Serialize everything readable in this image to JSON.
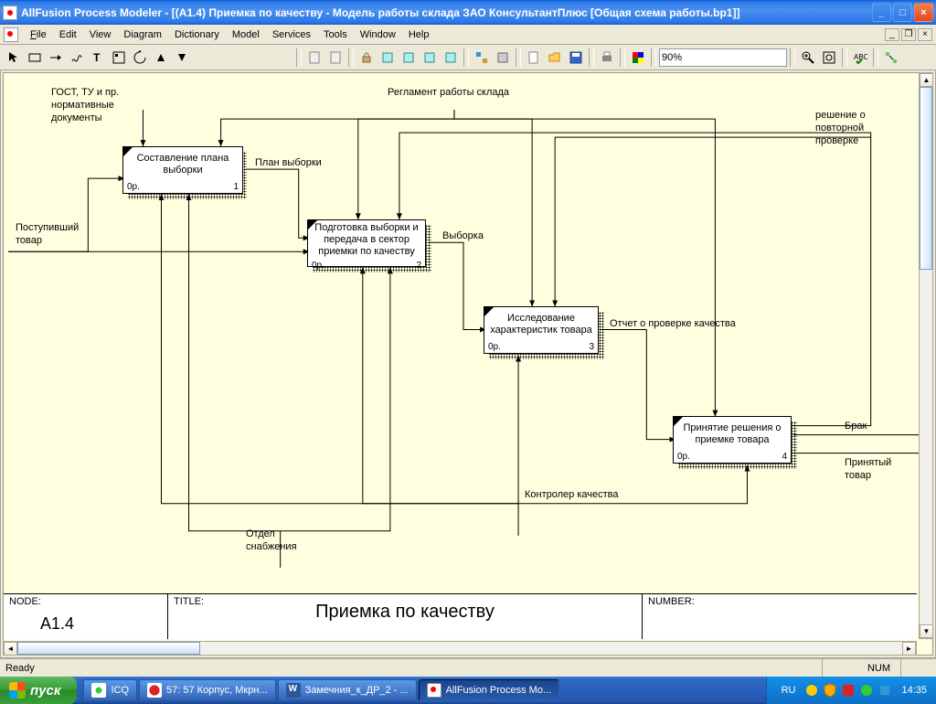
{
  "titlebar": {
    "text": "AllFusion Process Modeler  - [(A1.4) Приемка  по качеству  - Модель работы склада ЗАО КонсультантПлюс  [Общая схема работы.bp1]]"
  },
  "menu": {
    "file": "File",
    "edit": "Edit",
    "view": "View",
    "diagram": "Diagram",
    "dictionary": "Dictionary",
    "model": "Model",
    "services": "Services",
    "tools": "Tools",
    "window": "Window",
    "help": "Help"
  },
  "toolbar": {
    "zoom": "90%"
  },
  "diagram": {
    "labels": {
      "gost": "ГОСТ, ТУ и пр. нормативные документы",
      "reglament": "Регламент работы склада",
      "reshenie": "решение о повторной проверке",
      "plan": "План выборки",
      "postup": "Поступивший товар",
      "vyborka": "Выборка",
      "otchet": "Отчет о проверке качества",
      "brak": "Брак",
      "prinyat": "Принятый товар",
      "kontroler": "Контролер качества",
      "otdel": "Отдел снабжения"
    },
    "boxes": {
      "b1": {
        "label": "Составление плана выборки",
        "ref": "0р.",
        "num": "1"
      },
      "b2": {
        "label": "Подготовка выборки и передача в сектор приемки по качеству",
        "ref": "0р.",
        "num": "2"
      },
      "b3": {
        "label": "Исследование характеристик товара",
        "ref": "0р.",
        "num": "3"
      },
      "b4": {
        "label": "Принятие решения о приемке товара",
        "ref": "0р.",
        "num": "4"
      }
    },
    "titleblock": {
      "node_h": "NODE:",
      "node_v": "A1.4",
      "title_h": "TITLE:",
      "title_v": "Приемка  по качеству",
      "num_h": "NUMBER:"
    }
  },
  "status": {
    "ready": "Ready",
    "num": "NUM"
  },
  "taskbar": {
    "start": "пуск",
    "tasks": {
      "icq": "ICQ",
      "opera": "57: 57 Корпус, Мкрн...",
      "word": "Замечния_к_ДР_2 - ...",
      "app": "AllFusion Process Mo..."
    },
    "lang": "RU",
    "clock": "14:35"
  }
}
